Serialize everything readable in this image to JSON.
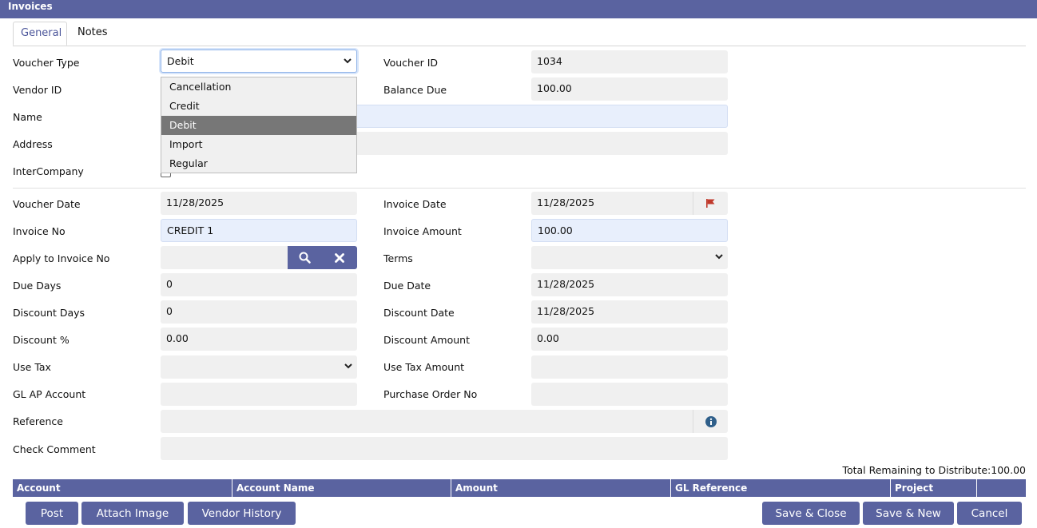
{
  "window": {
    "title": "Invoices"
  },
  "tabs": [
    {
      "label": "General"
    },
    {
      "label": "Notes"
    }
  ],
  "labels": {
    "voucher_type": "Voucher Type",
    "vendor_id": "Vendor ID",
    "name": "Name",
    "address": "Address",
    "intercompany": "InterCompany",
    "voucher_id": "Voucher ID",
    "balance_due": "Balance Due",
    "voucher_date": "Voucher Date",
    "invoice_no": "Invoice No",
    "apply_to_invoice_no": "Apply to Invoice No",
    "due_days": "Due Days",
    "discount_days": "Discount Days",
    "discount_pct": "Discount %",
    "use_tax": "Use Tax",
    "gl_ap_account": "GL AP Account",
    "reference": "Reference",
    "check_comment": "Check Comment",
    "invoice_date": "Invoice Date",
    "invoice_amount": "Invoice Amount",
    "terms": "Terms",
    "due_date": "Due Date",
    "discount_date": "Discount Date",
    "discount_amount": "Discount Amount",
    "use_tax_amount": "Use Tax Amount",
    "purchase_order_no": "Purchase Order No"
  },
  "values": {
    "voucher_type": "Debit",
    "voucher_id": "1034",
    "balance_due": "100.00",
    "voucher_date": "11/28/2025",
    "invoice_no": "CREDIT 1",
    "due_days": "0",
    "discount_days": "0",
    "discount_pct": "0.00",
    "invoice_date": "11/28/2025",
    "invoice_amount": "100.00",
    "due_date": "11/28/2025",
    "discount_date": "11/28/2025",
    "discount_amount": "0.00"
  },
  "voucher_type_options": [
    {
      "label": "Cancellation"
    },
    {
      "label": "Credit"
    },
    {
      "label": "Debit",
      "selected": true
    },
    {
      "label": "Import"
    },
    {
      "label": "Regular"
    }
  ],
  "total_remaining": "Total Remaining to Distribute:100.00",
  "grid_columns": [
    "Account",
    "Account Name",
    "Amount",
    "GL Reference",
    "Project"
  ],
  "buttons": {
    "post": "Post",
    "attach_image": "Attach Image",
    "vendor_history": "Vendor History",
    "save_close": "Save & Close",
    "save_new": "Save & New",
    "cancel": "Cancel"
  },
  "icons": {
    "search": "search-icon",
    "clear": "close-icon",
    "calendar_flag": "flag-icon",
    "info": "info-icon",
    "select_caret": "chevron-down-icon"
  },
  "colors": {
    "accent": "#5a63a0",
    "field_bg": "#f0f0f0",
    "field_focus_bg": "#e8effc",
    "flag": "#c0392b",
    "info": "#2f5f8a"
  }
}
